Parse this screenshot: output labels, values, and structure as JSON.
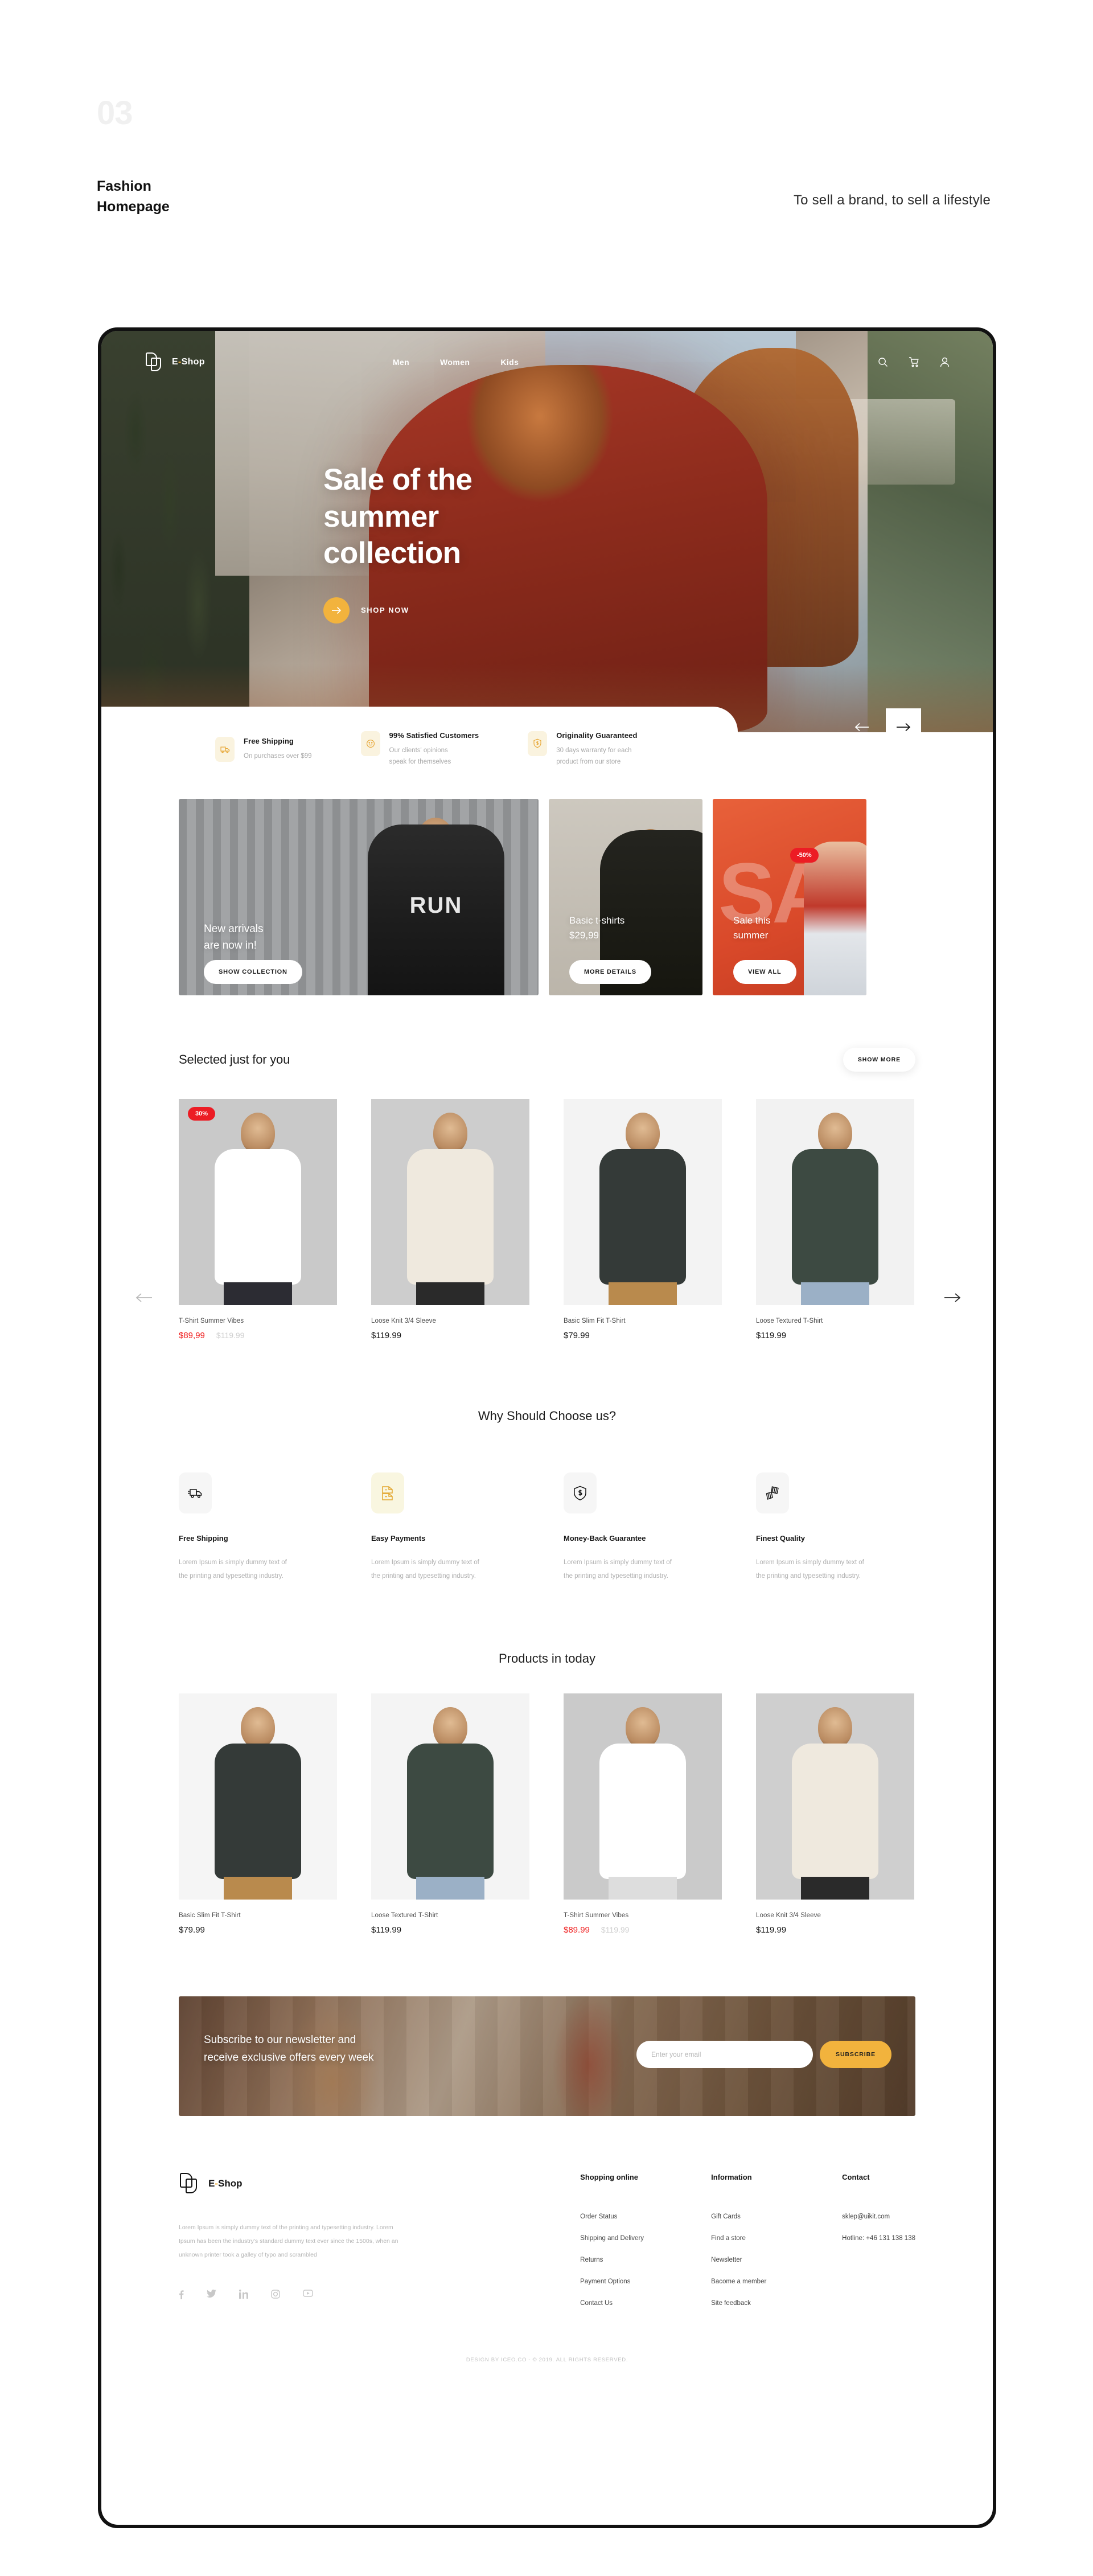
{
  "slide": {
    "number": "03",
    "title_line1": "Fashion",
    "title_line2": "Homepage",
    "tagline": "To sell a brand, to sell a lifestyle"
  },
  "nav": {
    "brand": "E",
    "brand_dot": "-",
    "brand_rest": "Shop",
    "links": [
      "Men",
      "Women",
      "Kids"
    ],
    "icons": [
      "search-icon",
      "cart-icon",
      "user-icon"
    ]
  },
  "hero": {
    "heading_line1": "Sale of the",
    "heading_line2": "summer",
    "heading_line3": "collection",
    "cta": "SHOP NOW"
  },
  "features": [
    {
      "icon": "truck-icon",
      "title": "Free Shipping",
      "sub1": "On purchases over $99",
      "sub2": ""
    },
    {
      "icon": "smile-icon",
      "title": "99% Satisfied Customers",
      "sub1": "Our clients' opinions",
      "sub2": "speak for themselves"
    },
    {
      "icon": "badge-dollar-icon",
      "title": "Originality Guaranteed",
      "sub1": "30 days warranty for each",
      "sub2": "product from our store"
    }
  ],
  "cards": [
    {
      "line1": "New arrivals",
      "line2": "are now in!",
      "button": "SHOW COLLECTION",
      "badge": ""
    },
    {
      "line1": "Basic t-shirts",
      "line2": "$29,99",
      "button": "MORE DETAILS",
      "badge": ""
    },
    {
      "line1": "Sale this",
      "line2": "summer",
      "button": "VIEW ALL",
      "badge": "-50%"
    }
  ],
  "selected": {
    "title": "Selected just for you",
    "show_more": "SHOW MORE",
    "products": [
      {
        "name": "T-Shirt Summer Vibes",
        "price": "$89,99",
        "old_price": "$119.99",
        "badge": "30%",
        "shirt": "#ffffff",
        "bg": "#c9c9c9",
        "legs": "#2c2c33"
      },
      {
        "name": "Loose Knit 3/4 Sleeve",
        "price": "$119.99",
        "old_price": "",
        "badge": "",
        "shirt": "#efe9de",
        "bg": "#cdcdcd",
        "legs": "#2a2a2a"
      },
      {
        "name": "Basic Slim Fit T-Shirt",
        "price": "$79.99",
        "old_price": "",
        "badge": "",
        "shirt": "#343a38",
        "bg": "#f3f3f3",
        "legs": "#b98a4d"
      },
      {
        "name": "Loose Textured T-Shirt",
        "price": "$119.99",
        "old_price": "",
        "badge": "",
        "shirt": "#3d4a42",
        "bg": "#f2f2f2",
        "legs": "#9bb0c6"
      }
    ]
  },
  "why": {
    "title": "Why Should Choose us?",
    "items": [
      {
        "icon": "truck-icon",
        "title": "Free Shipping",
        "text1": "Lorem Ipsum is simply dummy text of",
        "text2": "the printing and typesetting industry.",
        "highlight": false
      },
      {
        "icon": "payments-icon",
        "title": "Easy Payments",
        "text1": "Lorem Ipsum is simply dummy text of",
        "text2": "the printing and typesetting industry.",
        "highlight": true
      },
      {
        "icon": "shield-dollar-icon",
        "title": "Money-Back Guarantee",
        "text1": "Lorem Ipsum is simply dummy text of",
        "text2": "the printing and typesetting industry.",
        "highlight": false
      },
      {
        "icon": "quality-fabric-icon",
        "title": "Finest Quality",
        "text1": "Lorem Ipsum is simply dummy text of",
        "text2": "the printing and typesetting industry.",
        "highlight": false
      }
    ]
  },
  "today": {
    "title": "Products in today",
    "products": [
      {
        "name": "Basic Slim Fit T-Shirt",
        "price": "$79.99",
        "old_price": "",
        "shirt": "#343a38",
        "bg": "#f5f5f5",
        "legs": "#b98a4d"
      },
      {
        "name": "Loose Textured T-Shirt",
        "price": "$119.99",
        "old_price": "",
        "shirt": "#3d4a42",
        "bg": "#f4f4f4",
        "legs": "#9bb0c6"
      },
      {
        "name": "T-Shirt Summer Vibes",
        "price": "$89.99",
        "old_price": "$119.99",
        "shirt": "#ffffff",
        "bg": "#cacaca",
        "legs": "#dddddd"
      },
      {
        "name": "Loose Knit 3/4 Sleeve",
        "price": "$119.99",
        "old_price": "",
        "shirt": "#efe9de",
        "bg": "#cfcfcf",
        "legs": "#2a2a2a"
      }
    ]
  },
  "newsletter": {
    "line1": "Subscribe to our newsletter and",
    "line2": "receive exclusive offers every week",
    "placeholder": "Enter your email",
    "button": "SUBSCRIBE"
  },
  "footer": {
    "brand": "E",
    "brand_dot": "-",
    "brand_rest": "Shop",
    "about": "Lorem Ipsum is simply dummy text of the printing and typesetting industry. Lorem Ipsum has been the industry's standard dummy text ever since the 1500s, when an unknown printer took a galley of typo and scrambled",
    "social": [
      "facebook-icon",
      "twitter-icon",
      "linkedin-icon",
      "instagram-icon",
      "youtube-icon"
    ],
    "columns": [
      {
        "heading": "Shopping online",
        "links": [
          "Order Status",
          "Shipping and Delivery",
          "Returns",
          "Payment Options",
          "Contact Us"
        ]
      },
      {
        "heading": "Information",
        "links": [
          "Gift Cards",
          "Find a store",
          "Newsletter",
          "Bacome a member",
          "Site feedback"
        ]
      },
      {
        "heading": "Contact",
        "links": [
          "sklep@uikit.com",
          "Hotline: +46 131 138 138"
        ]
      }
    ],
    "copyright": "DESIGN BY ICEO.CO - © 2019. ALL RIGHTS RESERVED."
  },
  "colors": {
    "accent": "#f2b33d",
    "sale_red": "#ec1c24",
    "price_red": "#f01f1f",
    "dark": "#111111"
  }
}
